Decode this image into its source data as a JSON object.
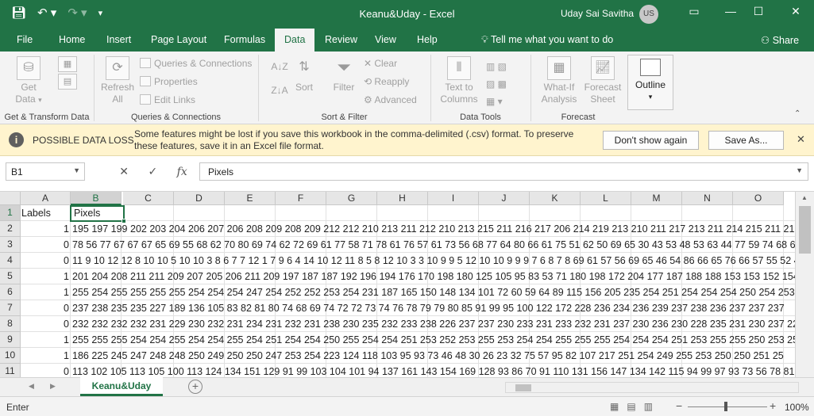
{
  "window": {
    "title": "Keanu&Uday  -  Excel",
    "user_name": "Uday Sai Savitha",
    "user_initials": "US",
    "quick_access": [
      "save",
      "undo",
      "redo",
      "customize"
    ],
    "controls": [
      "ribbon-display",
      "minimize",
      "maximize",
      "close"
    ]
  },
  "tabs": [
    "File",
    "Home",
    "Insert",
    "Page Layout",
    "Formulas",
    "Data",
    "Review",
    "View",
    "Help"
  ],
  "active_tab": "Data",
  "tell_me": "Tell me what you want to do",
  "share": "Share",
  "ribbon": {
    "get_data": "Get Data",
    "get_data_arrow": "▾",
    "refresh_all": "Refresh All",
    "queries_connections": "Queries & Connections",
    "properties": "Properties",
    "edit_links": "Edit Links",
    "sort": "Sort",
    "filter": "Filter",
    "clear": "Clear",
    "reapply": "Reapply",
    "advanced": "Advanced",
    "text_to_columns": "Text to Columns",
    "what_if": "What-If Analysis",
    "forecast_sheet": "Forecast Sheet",
    "outline": "Outline",
    "groups": {
      "get_transform": "Get & Transform Data",
      "queries": "Queries & Connections",
      "sort_filter": "Sort & Filter",
      "data_tools": "Data Tools",
      "forecast": "Forecast"
    }
  },
  "message_bar": {
    "title": "POSSIBLE DATA LOSS",
    "text": "Some features might be lost if you save this workbook in the comma-delimited (.csv) format. To preserve these features, save it in an Excel file format.",
    "dont_show": "Don't show again",
    "save_as": "Save As...",
    "color": "#fff4ce"
  },
  "formula_bar": {
    "name_box": "B1",
    "cancel": "✕",
    "enter": "✓",
    "fx": "fx",
    "content": "Pixels"
  },
  "columns": [
    "A",
    "B",
    "C",
    "D",
    "E",
    "F",
    "G",
    "H",
    "I",
    "J",
    "K",
    "L",
    "M",
    "N",
    "O"
  ],
  "selected_column": "B",
  "rows": [
    {
      "n": "1",
      "a": "Labels",
      "b": "Pixels"
    },
    {
      "n": "2",
      "a": "1",
      "b": "195 197 199 202 203 204 206 207 206 208 209 208 209 212 212 210 213 211 212 210 213 215 211 216 217 206 214 219 213 210 211 217 213 211 214 215 211 216"
    },
    {
      "n": "3",
      "a": "0",
      "b": "78 56 77 67 67 67 65 69 55 68 62 70 80 69 74 62 72 69 61 77 58 71 78 61 76 57 61 73 56 68 77 64 80 66 61 75 51 62 50 69 65 30 43 53 48 53 63 44 77 59 74 68 67 6"
    },
    {
      "n": "4",
      "a": "0",
      "b": "11 9 10 12 12 8 10 10 5 10 10 3 8 6 7 7 12 1 7 9 6 4 14 10 12 11 8 5 8 12 10 3 3 10 9 9 5 12 10 10 9 9 9 7 6 8 7 8 69 61 57 56 69 65 46 54 86 66 65 76 66 57 55 52 49 4"
    },
    {
      "n": "5",
      "a": "1",
      "b": "201 204 208 211 211 209 207 205 206 211 209 197 187 187 192 196 194 176 170 198 180 125 105 95 83 53 71 180 198 172 204 177 187 188 188 153 153 152 154"
    },
    {
      "n": "6",
      "a": "1",
      "b": "255 254 255 255 255 255 254 254 254 247 254 252 252 253 254 231 187 165 150 148 134 101 72 60 59 64 89 115 156 205 235 254 251 254 254 254 250 254 253 2"
    },
    {
      "n": "7",
      "a": "0",
      "b": "237 238 235 235 227 189 136 105 83 82 81 80 74 68 69 74 72 72 73 74 76 78 79 79 80 85 91 99 95 100 122 172 228 236 234 236 239 237 238 236 237 237 237"
    },
    {
      "n": "8",
      "a": "0",
      "b": "232 232 232 232 231 229 230 232 231 234 231 232 231 238 230 235 232 233 238 226 237 237 230 233 231 233 232 231 237 230 236 230 228 235 231 230 237 224"
    },
    {
      "n": "9",
      "a": "1",
      "b": "255 255 255 254 254 255 254 254 255 254 251 254 254 250 255 254 254 251 253 252 253 255 253 254 254 255 255 255 254 254 254 251 253 255 255 250 253 255"
    },
    {
      "n": "10",
      "a": "1",
      "b": "186 225 245 247 248 248 250 249 250 250 247 253 254 223 124 118 103 95 93 73 46 48 30 26 23 32 75 57 95 82 107 217 251 254 249 255 253 250 250 251 25"
    },
    {
      "n": "11",
      "a": "0",
      "b": "113 102 105 113 105 100 113 124 134 151 129 91 99 103 104 101 94 137 161 143 154 169 128 93 86 70 91 110 131 156 147 134 142 115 94 99 97 93 73 56 78 81 6"
    }
  ],
  "sheet": {
    "name": "Keanu&Uday",
    "add": "+"
  },
  "status": {
    "mode": "Enter",
    "zoom": "100%",
    "zoom_minus": "−",
    "zoom_plus": "+"
  }
}
